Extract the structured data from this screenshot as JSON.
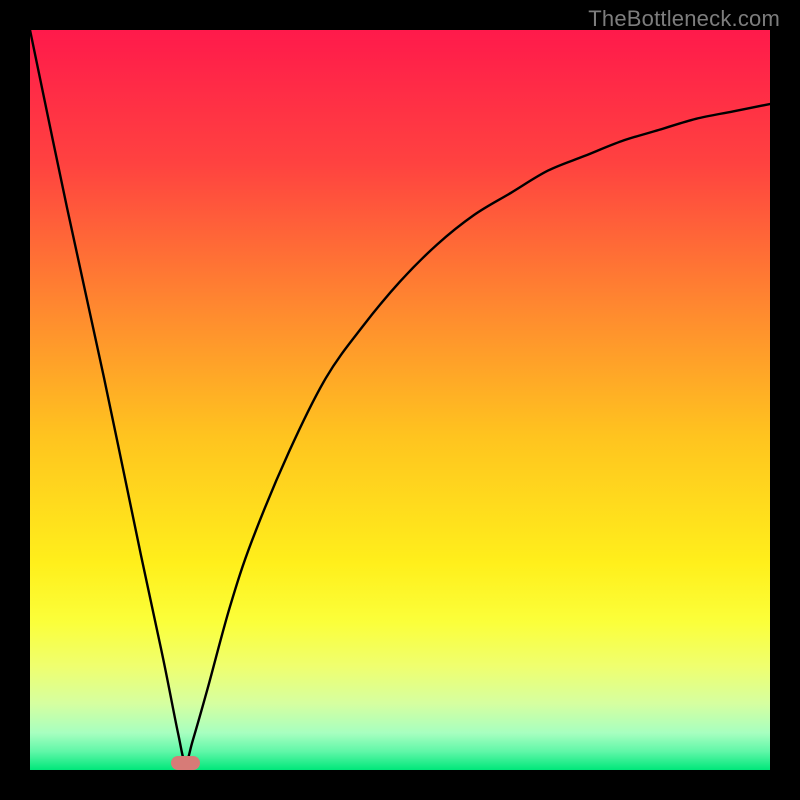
{
  "watermark": "TheBottleneck.com",
  "chart_data": {
    "type": "line",
    "title": "",
    "xlabel": "",
    "ylabel": "",
    "xlim": [
      0,
      100
    ],
    "ylim": [
      0,
      100
    ],
    "optimal_x": 21,
    "gradient_stops": [
      {
        "offset": 0.0,
        "color": "#ff1a4b"
      },
      {
        "offset": 0.18,
        "color": "#ff4240"
      },
      {
        "offset": 0.38,
        "color": "#ff8a2f"
      },
      {
        "offset": 0.55,
        "color": "#ffc41f"
      },
      {
        "offset": 0.72,
        "color": "#ffef1b"
      },
      {
        "offset": 0.8,
        "color": "#fbff3a"
      },
      {
        "offset": 0.86,
        "color": "#efff6f"
      },
      {
        "offset": 0.91,
        "color": "#d6ffa0"
      },
      {
        "offset": 0.95,
        "color": "#a7ffc0"
      },
      {
        "offset": 0.975,
        "color": "#60f7a8"
      },
      {
        "offset": 1.0,
        "color": "#00e77a"
      }
    ],
    "series": [
      {
        "name": "bottleneck-curve",
        "x": [
          0,
          5,
          10,
          15,
          18,
          20,
          21,
          22,
          24,
          27,
          30,
          35,
          40,
          45,
          50,
          55,
          60,
          65,
          70,
          75,
          80,
          85,
          90,
          95,
          100
        ],
        "y": [
          100,
          76,
          53,
          29,
          15,
          5,
          1,
          4,
          11,
          22,
          31,
          43,
          53,
          60,
          66,
          71,
          75,
          78,
          81,
          83,
          85,
          86.5,
          88,
          89,
          90
        ]
      }
    ],
    "marker": {
      "x_center_pct": 21,
      "width_pct": 4,
      "color": "#d77b77"
    }
  }
}
